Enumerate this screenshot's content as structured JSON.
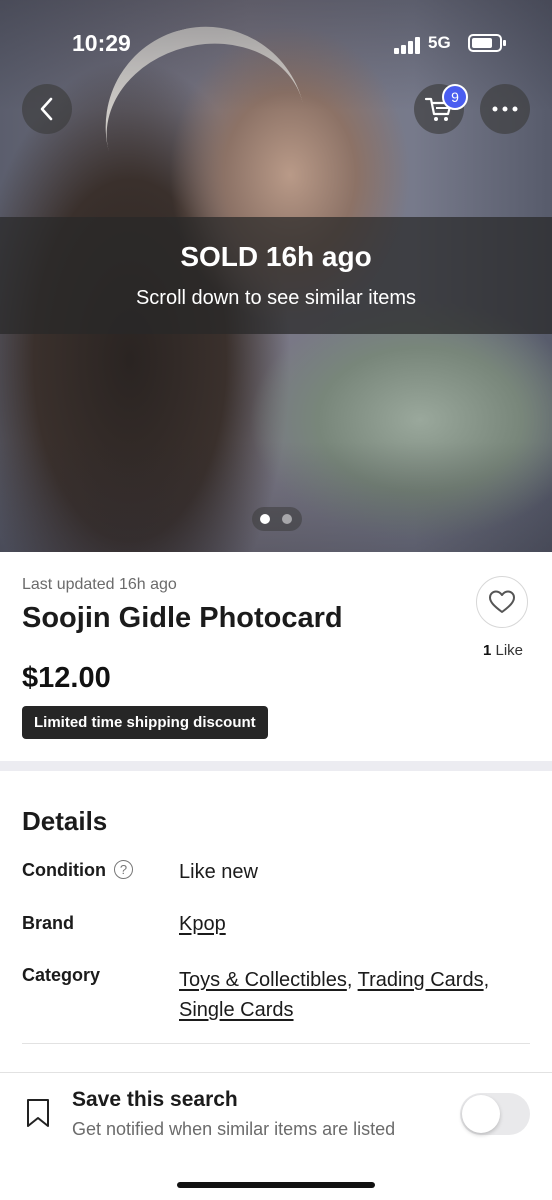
{
  "status_bar": {
    "time": "10:29",
    "network": "5G"
  },
  "header": {
    "cart_count": "9"
  },
  "sold_banner": {
    "title": "SOLD 16h ago",
    "subtitle": "Scroll down to see similar items"
  },
  "carousel": {
    "total_images": 2,
    "active_index": 0
  },
  "product": {
    "updated": "Last updated 16h ago",
    "title": "Soojin Gidle Photocard",
    "likes_count": "1",
    "likes_label": "Like",
    "price": "$12.00",
    "shipping_badge": "Limited time shipping discount"
  },
  "details": {
    "heading": "Details",
    "condition_label": "Condition",
    "condition_help": "?",
    "condition_value": "Like new",
    "brand_label": "Brand",
    "brand_value": "Kpop",
    "category_label": "Category",
    "category_1": "Toys & Collectibles",
    "category_sep_1": ",",
    "category_2": "Trading Cards",
    "category_sep_2": ",",
    "category_3": "Single Cards"
  },
  "save_search": {
    "title": "Save this search",
    "subtitle": "Get notified when similar items are listed",
    "toggle_on": false
  },
  "colors": {
    "badge_blue": "#4a5df0",
    "banner_overlay": "rgba(40,40,40,0.72)",
    "dark_badge": "#262626"
  }
}
